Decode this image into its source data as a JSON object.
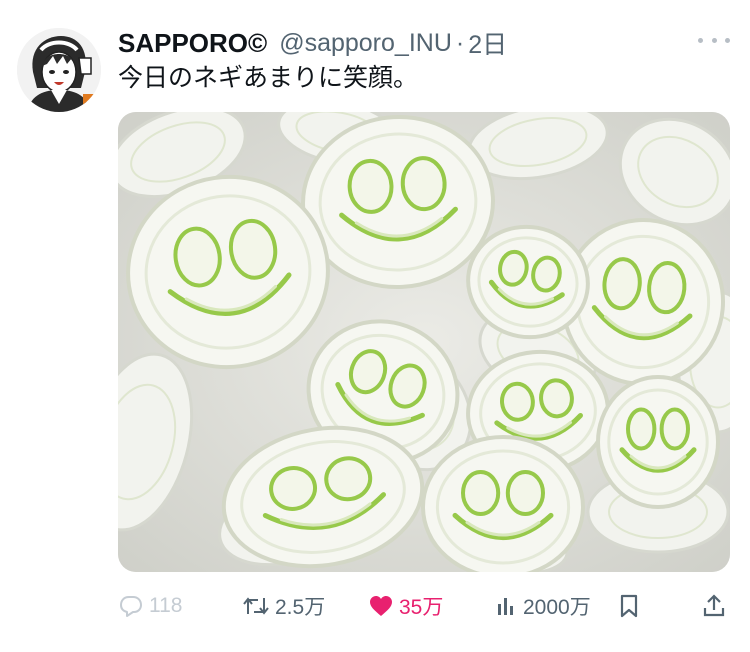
{
  "colors": {
    "like": "#e8216f",
    "muted": "#536471",
    "faded": "#c5ccd3",
    "text": "#0f1419"
  },
  "author": {
    "display_name": "SAPPORO©",
    "handle": "@sapporo_INU",
    "separator": "·",
    "time": "2日",
    "avatar_icon": "avatar-manga-character"
  },
  "tweet": {
    "text": "今日のネギあまりに笑顔。",
    "media_icon": "photo-smiling-green-onion-slices"
  },
  "actions": {
    "replies": "118",
    "retweets": "2.5万",
    "likes": "35万",
    "views": "2000万",
    "icons": [
      "reply-icon",
      "retweet-icon",
      "heart-icon",
      "views-icon",
      "bookmark-icon",
      "share-icon"
    ]
  }
}
